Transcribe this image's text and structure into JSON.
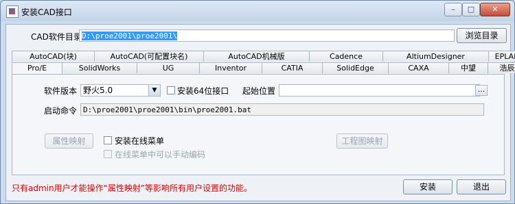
{
  "window": {
    "title": "安装CAD接口",
    "min_label": "–",
    "max_label": "□",
    "close_label": "✕"
  },
  "cad_dir": {
    "label": "CAD软件目录",
    "value": "D:\\proe2001\\proe2001\\",
    "browse_label": "浏览目录"
  },
  "tabs_back": [
    "AutoCAD(块)",
    "AutoCAD(可配置块名)",
    "AutoCAD机械版",
    "Cadence",
    "AltiumDesigner",
    "EPLAN"
  ],
  "tabs_front": [
    "Pro/E",
    "SolidWorks",
    "UG",
    "Inventor",
    "CATIA",
    "SolidEdge",
    "CAXA",
    "中望",
    "浩辰"
  ],
  "active_tab": "Pro/E",
  "panel": {
    "version_label": "软件版本",
    "version_value": "野火5.0",
    "install64_label": "安装64位接口",
    "start_pos_label": "起始位置",
    "start_pos_value": "",
    "browse_dots": "...",
    "launch_label": "启动命令",
    "launch_value": "D:\\proe2001\\proe2001\\bin\\proe2001.bat",
    "attr_map_label": "属性映射",
    "online_menu_label": "安装在线菜单",
    "manual_code_label": "在线菜单中可以手动编码",
    "drawing_map_label": "工程图映射"
  },
  "footer": {
    "note": "只有admin用户才能操作“属性映射”等影响所有用户设置的功能。",
    "install_label": "安装",
    "exit_label": "退出"
  },
  "colors": {
    "note_color": "#e00000",
    "selection": "#3399ff"
  }
}
